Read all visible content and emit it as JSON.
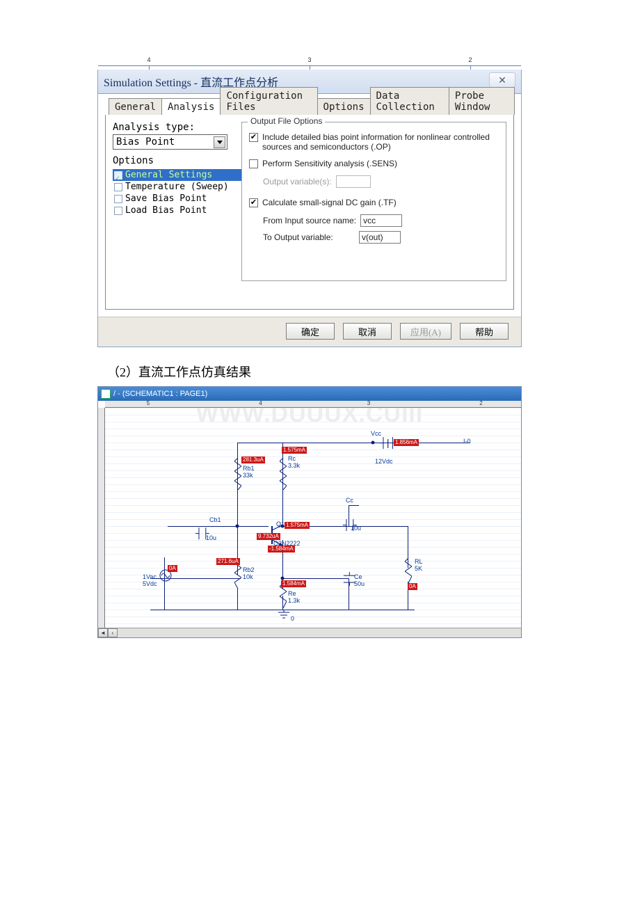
{
  "dialog": {
    "title": "Simulation Settings - 直流工作点分析",
    "tabs": [
      "General",
      "Analysis",
      "Configuration Files",
      "Options",
      "Data Collection",
      "Probe Window"
    ],
    "active_tab": 1,
    "ruler_marks": [
      "4",
      "3",
      "2"
    ],
    "left": {
      "analysis_type_label": "Analysis type:",
      "analysis_type_value": "Bias Point",
      "options_label": "Options",
      "items": [
        {
          "label": "General Settings",
          "selected": true,
          "checked": true
        },
        {
          "label": "Temperature (Sweep)",
          "selected": false,
          "checked": false
        },
        {
          "label": "Save Bias Point",
          "selected": false,
          "checked": false
        },
        {
          "label": "Load Bias Point",
          "selected": false,
          "checked": false
        }
      ]
    },
    "output_options": {
      "legend": "Output File Options",
      "include_detailed": {
        "checked": true,
        "text": "Include detailed bias point information for nonlinear controlled sources and semiconductors (.OP)"
      },
      "perform_sens": {
        "checked": false,
        "text": "Perform Sensitivity analysis (.SENS)"
      },
      "output_var_label": "Output variable(s):",
      "output_var_value": "",
      "calc_tf": {
        "checked": true,
        "text": "Calculate small-signal DC gain (.TF)"
      },
      "from_label": "From Input source name:",
      "from_value": "vcc",
      "to_label": "To Output variable:",
      "to_value": "v(out)"
    },
    "buttons": {
      "ok": "确定",
      "cancel": "取消",
      "apply": "应用(A)",
      "help": "帮助"
    }
  },
  "caption_2": "（2）直流工作点仿真结果",
  "viewer": {
    "title": "/ - (SCHEMATIC1 : PAGE1)",
    "ruler_top": [
      "5",
      "4",
      "3",
      "2"
    ],
    "watermark": "WWW.DUUUX.CUIII",
    "components": {
      "Vcc": {
        "label": "Vcc",
        "value": "12Vdc"
      },
      "Rb1": {
        "label": "Rb1",
        "value": "33k",
        "current": "281.3uA"
      },
      "Rb2": {
        "label": "Rb2",
        "value": "10k",
        "current": "271.6uA"
      },
      "Rc": {
        "label": "Rc",
        "value": "3.3k",
        "current": "1.575mA"
      },
      "Re": {
        "label": "Re",
        "value": "1.3k",
        "current": "1.584mA"
      },
      "RL": {
        "label": "RL",
        "value": "5K",
        "current": "0A"
      },
      "Cb1": {
        "label": "Cb1",
        "value": "10u"
      },
      "Cc": {
        "label": "Cc",
        "value": "10u"
      },
      "Ce": {
        "label": "Ce",
        "value": "50u"
      },
      "Q1": {
        "label": "Q1",
        "model": "Q2N2222",
        "ic": "1.575mA",
        "ib": "9.732uA",
        "ie": "-1.584mA"
      },
      "Vsrc": {
        "vac": "1Vac",
        "vdc": "5Vdc",
        "current": "0A"
      },
      "Vcc_src_current": "1.856mA",
      "port_I0": "I-0",
      "gnd_label": "0"
    }
  }
}
